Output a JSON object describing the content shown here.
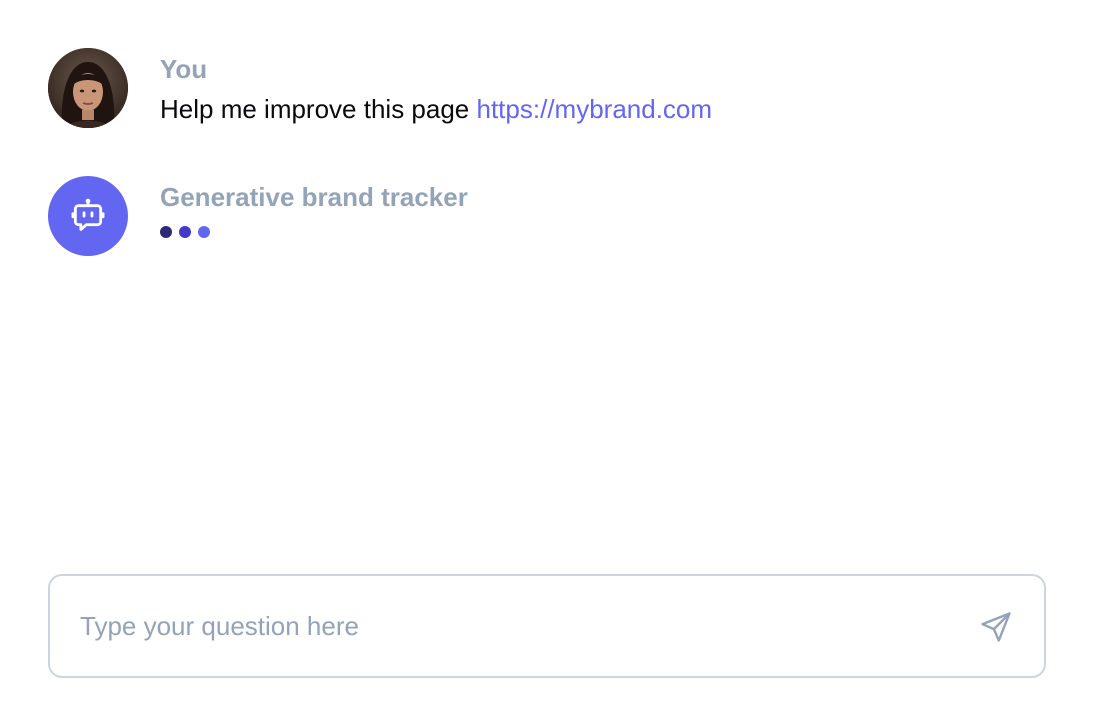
{
  "colors": {
    "accent": "#6366f1",
    "muted": "#94a3b8",
    "border": "#cbd5e1",
    "text": "#0b0b0f",
    "dots": [
      "#2e2a78",
      "#4338ca",
      "#6366f1"
    ]
  },
  "messages": [
    {
      "sender": "You",
      "avatar": "user-photo",
      "text": "Help me improve this page",
      "link": "https://mybrand.com"
    },
    {
      "sender": "Generative brand tracker",
      "avatar": "robot-icon",
      "typing": true
    }
  ],
  "composer": {
    "placeholder": "Type your question here",
    "send_icon": "send-icon"
  }
}
